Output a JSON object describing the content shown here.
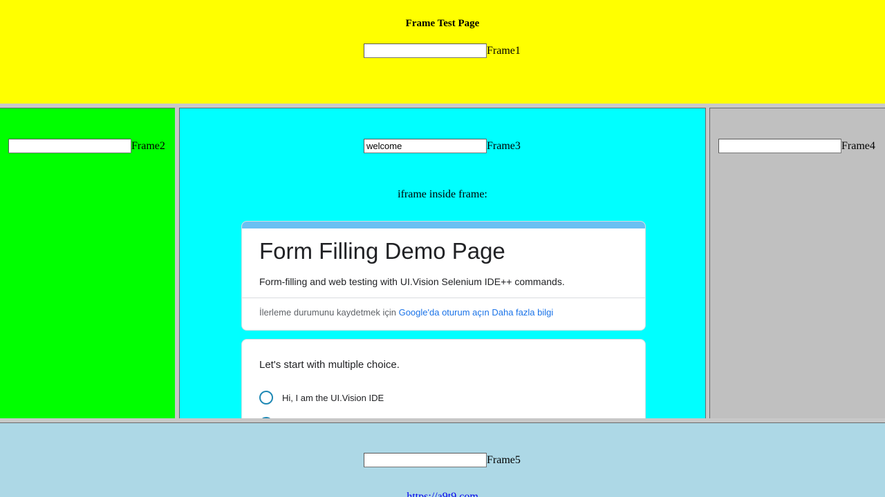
{
  "frame1": {
    "title": "Frame Test Page",
    "input_value": "",
    "label": "Frame1"
  },
  "frame2": {
    "input_value": "",
    "label": "Frame2"
  },
  "frame3": {
    "input_value": "welcome",
    "label": "Frame3",
    "iframe_caption": "iframe inside frame:",
    "form": {
      "title": "Form Filling Demo Page",
      "description": "Form-filling and web testing with UI.Vision Selenium IDE++ commands.",
      "signin_prefix": "İlerleme durumunu kaydetmek için ",
      "signin_link": "Google'da oturum açın",
      "more_info_link": "Daha fazla bilgi",
      "question": "Let's start with multiple choice.",
      "options": [
        "Hi, I am the UI.Vision IDE",
        ""
      ]
    }
  },
  "frame4": {
    "input_value": "",
    "label": "Frame4"
  },
  "frame5": {
    "input_value": "",
    "label": "Frame5",
    "link_text": "https://a9t9.com"
  },
  "colors": {
    "frame1_bg": "#ffff00",
    "frame2_bg": "#00ff00",
    "frame3_bg": "#00ffff",
    "frame4_bg": "#c0c0c0",
    "frame5_bg": "#add8e6",
    "form_accent": "#6ac0f2",
    "link": "#1a73e8"
  }
}
